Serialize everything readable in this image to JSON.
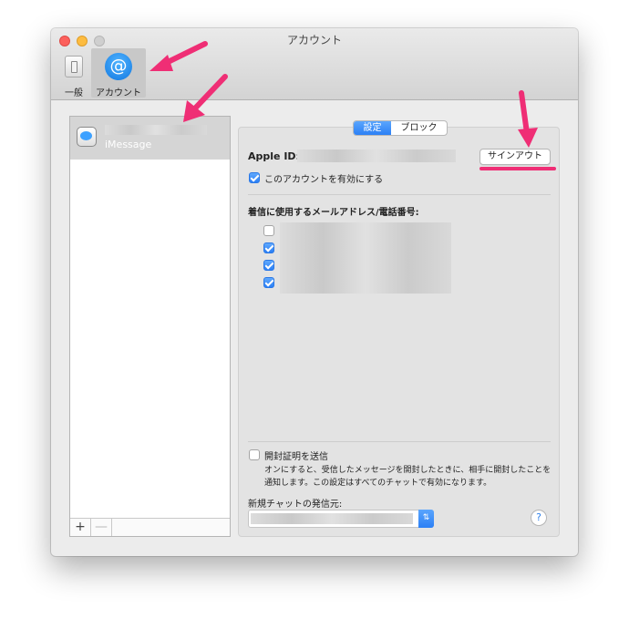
{
  "window": {
    "title": "アカウント",
    "toolbar": {
      "general_label": "一般",
      "account_label": "アカウント",
      "at_symbol": "@"
    }
  },
  "sidebar": {
    "account": {
      "service": "iMessage",
      "icon": "messages-icon"
    },
    "add_label": "+",
    "remove_label": "—"
  },
  "tabs": {
    "settings": "設定",
    "block": "ブロック",
    "selected": "設定"
  },
  "settings": {
    "apple_id_label": "Apple ID:",
    "signout_label": "サインアウト",
    "enable_account_label": "このアカウントを有効にする",
    "enable_account_checked": true,
    "reach_header": "着信に使用するメールアドレス/電話番号:",
    "reach_items_checked": [
      false,
      true,
      true,
      true
    ],
    "read_receipts_label": "開封証明を送信",
    "read_receipts_checked": false,
    "read_receipts_desc": "オンにすると、受信したメッセージを開封したときに、相手に開封したことを通知します。この設定はすべてのチャットで有効になります。",
    "new_chat_from_label": "新規チャットの発信元:",
    "help_label": "?"
  },
  "annotations": {
    "arrow_color": "#ef2e75"
  },
  "colors": {
    "accent": "#2c80f5",
    "window_bg": "#ececec",
    "panel_bg": "#e3e3e3"
  }
}
